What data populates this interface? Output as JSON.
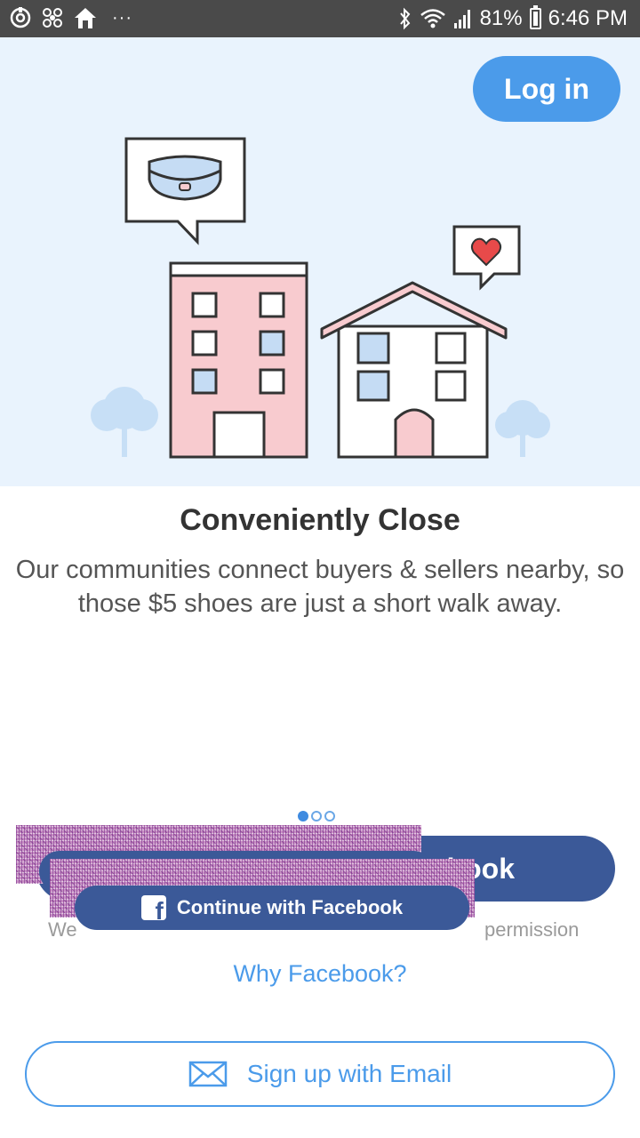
{
  "status_bar": {
    "battery_percent": "81%",
    "time": "6:46 PM",
    "more": "···"
  },
  "header": {
    "login_label": "Log in"
  },
  "onboarding": {
    "title": "Conveniently Close",
    "body": "Our communities connect buyers & sellers nearby, so those $5 shoes are just a short walk away.",
    "page_index": 1,
    "page_count": 3
  },
  "auth": {
    "facebook_big_label_fragment": "book",
    "facebook_label": "Continue with Facebook",
    "disclaimer_left_fragment": "We",
    "disclaimer_right_fragment": "permission",
    "why_facebook": "Why Facebook?",
    "email_label": "Sign up with Email"
  },
  "colors": {
    "status_bar": "#4a4a4a",
    "hero_background": "#e9f3fd",
    "accent_blue": "#4b9bea",
    "facebook_blue": "#3b5998",
    "building_pink": "#f8cbcf"
  }
}
